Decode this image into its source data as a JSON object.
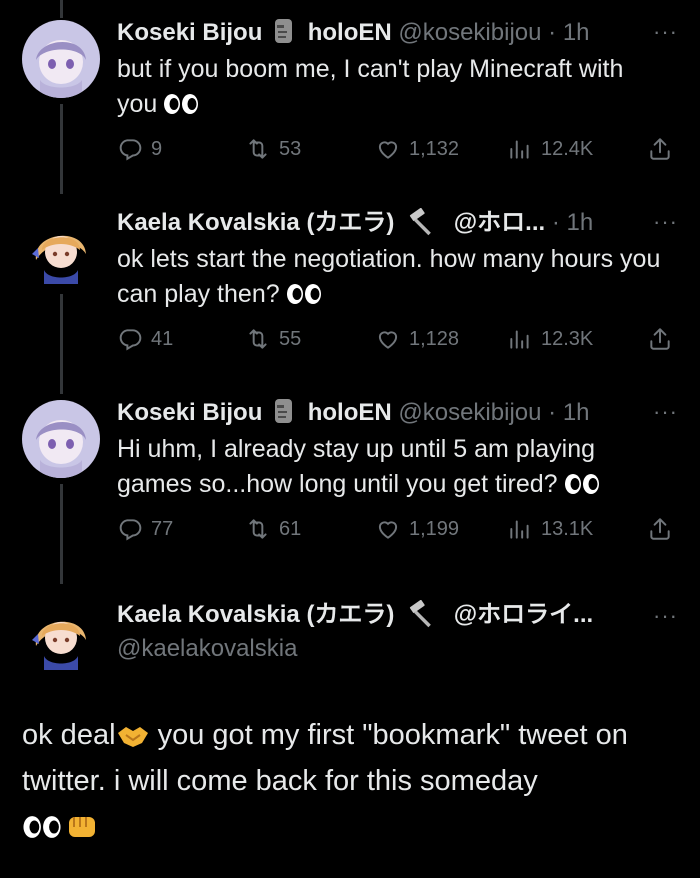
{
  "tweets": [
    {
      "name": "Koseki Bijou",
      "org": "holoEN",
      "handle": "@kosekibijou",
      "sep": "·",
      "time": "1h",
      "text": "but if you boom me, I can't play Minecraft with you",
      "replies": "9",
      "retweets": "53",
      "likes": "1,132",
      "views": "12.4K"
    },
    {
      "name": "Kaela Kovalskia (カエラ)",
      "handle": "@ホロ...",
      "sep": "·",
      "time": "1h",
      "text": "ok lets start the negotiation. how many hours you can play then?",
      "replies": "41",
      "retweets": "55",
      "likes": "1,128",
      "views": "12.3K"
    },
    {
      "name": "Koseki Bijou",
      "org": "holoEN",
      "handle": "@kosekibijou",
      "sep": "·",
      "time": "1h",
      "text": "Hi uhm, I already stay up until 5 am playing games so...how long until you get tired?",
      "replies": "77",
      "retweets": "61",
      "likes": "1,199",
      "views": "13.1K"
    }
  ],
  "focused": {
    "name": "Kaela Kovalskia (カエラ)",
    "handle_short": "@ホロライ...",
    "handle": "@kaelakovalskia",
    "text_a": "ok deal",
    "text_b": " you got my first \"bookmark\" tweet on twitter. i will come back for this someday"
  },
  "more_label": "···"
}
